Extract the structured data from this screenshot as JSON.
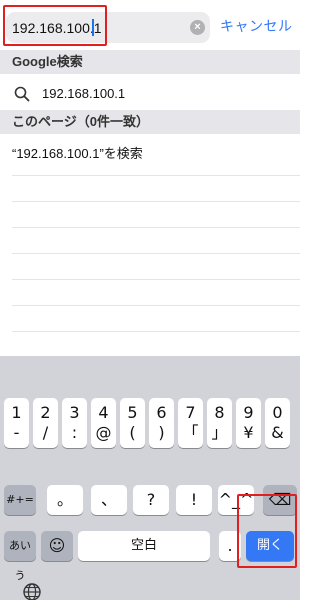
{
  "search": {
    "value": "192.168.100.1",
    "cancel_label": "キャンセル",
    "clear_symbol": "×"
  },
  "google_section": {
    "header": "Google検索",
    "suggestion": "192.168.100.1"
  },
  "page_section": {
    "header": "このページ（0件一致）",
    "find_text": "“192.168.100.1”を検索"
  },
  "keyboard": {
    "row1": [
      "1",
      "2",
      "3",
      "4",
      "5",
      "6",
      "7",
      "8",
      "9",
      "0"
    ],
    "row2": [
      "-",
      "/",
      ":",
      "@",
      "(",
      ")",
      "「",
      "」",
      "¥",
      "&"
    ],
    "row3": [
      "#+=",
      "。",
      "、",
      "?",
      "!",
      "^_^",
      "⌫"
    ],
    "row4": [
      "あいう",
      "☺",
      "空白",
      ".",
      "開く"
    ]
  },
  "colors": {
    "accent": "#3478f6",
    "highlight": "#e02020"
  }
}
